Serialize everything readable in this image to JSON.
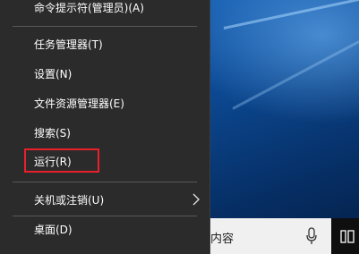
{
  "menu": {
    "items": [
      {
        "label": "命令提示符(管理员)(A)"
      },
      {
        "label": "任务管理器(T)"
      },
      {
        "label": "设置(N)"
      },
      {
        "label": "文件资源管理器(E)"
      },
      {
        "label": "搜索(S)"
      },
      {
        "label": "运行(R)"
      },
      {
        "label": "关机或注销(U)"
      },
      {
        "label": "桌面(D)"
      }
    ],
    "highlight_color": "#e8202a"
  },
  "taskbar": {
    "search_placeholder": "内容",
    "mic_icon": "microphone-icon",
    "taskview_icon": "task-view-icon"
  },
  "colors": {
    "menu_bg": "#2b2b2b",
    "desktop": "#0d4c98"
  }
}
